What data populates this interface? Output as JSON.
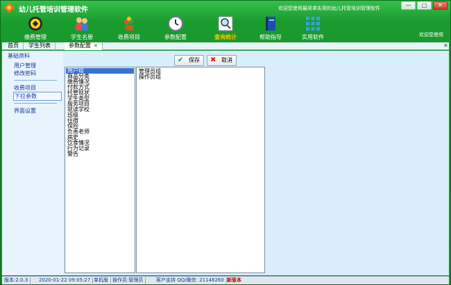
{
  "window": {
    "title": "幼儿托管培训管理软件",
    "welcome_top": "欢迎您使用最简单实用的幼儿托管培训管理软件",
    "controls": {
      "minimize": "—",
      "maximize": "□",
      "close": "✕"
    }
  },
  "toolbar": {
    "items": [
      {
        "label": "缴费管理",
        "icon": "coin-icon"
      },
      {
        "label": "学生名册",
        "icon": "students-icon"
      },
      {
        "label": "收费项目",
        "icon": "plant-icon"
      },
      {
        "label": "参数配置",
        "icon": "clock-icon"
      },
      {
        "label": "查询统计",
        "icon": "magnifier-icon",
        "active": true
      },
      {
        "label": "帮助指导",
        "icon": "book-icon"
      },
      {
        "label": "实用软件",
        "icon": "apps-grid-icon"
      }
    ],
    "welcome_right": "欢迎您使用"
  },
  "tabs": [
    {
      "label": "首页"
    },
    {
      "label": "学生列表"
    },
    {
      "label": "参数配置",
      "active": true,
      "closable": true
    }
  ],
  "tabbar_close": "✕",
  "sidebar": {
    "heading": "基础资料",
    "items": [
      {
        "label": "用户管理"
      },
      {
        "label": "修改密码"
      },
      {
        "label": "收费项目"
      },
      {
        "label": "下拉参数",
        "selected": true
      },
      {
        "label": "界面设置"
      }
    ]
  },
  "buttons": {
    "save": "保存",
    "cancel": "取消"
  },
  "categories": {
    "items": [
      "用户组",
      "商品分类",
      "缴费情况",
      "付款方式",
      "托管现状",
      "学生类型",
      "服务项目",
      "就读学校",
      "班级",
      "住宿",
      "保险",
      "负责老师",
      "病史",
      "饮食情况",
      "行为记录",
      "警告"
    ],
    "selected_index": 0
  },
  "values": {
    "items": [
      "管理员组",
      "操作员组"
    ]
  },
  "statusbar": {
    "version": "版本:2.0.3",
    "datetime": "2020-01-22 09:05:27",
    "edition": "单机版",
    "operator": "操作员:管理员",
    "support": "客户支持 QQ/微信: 21148260",
    "new_version": "新版本"
  },
  "colors": {
    "frame_green": "#1a9b2e",
    "content_bg": "#d9eefa",
    "selection_blue": "#3a73cf",
    "active_tool_label": "#ffc400"
  }
}
